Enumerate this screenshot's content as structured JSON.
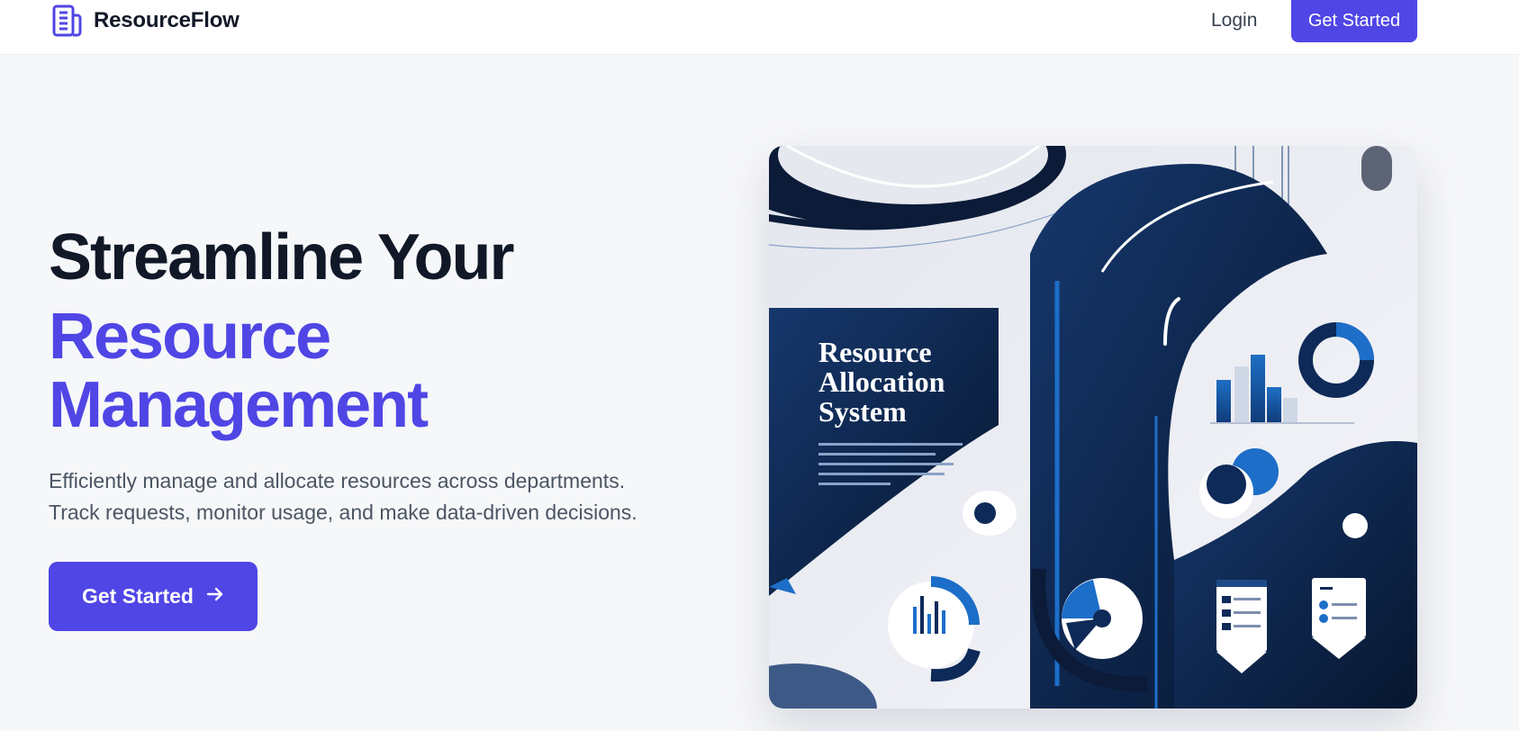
{
  "nav": {
    "brand": "ResourceFlow",
    "login": "Login",
    "cta": "Get Started"
  },
  "hero": {
    "title_line1": "Streamline Your",
    "title_line2": "Resource",
    "title_line3": "Management",
    "subtitle_line1": "Efficiently manage and allocate resources across departments.",
    "subtitle_line2": "Track requests, monitor usage, and make data-driven decisions.",
    "cta": "Get Started",
    "cta_icon": "arrow-right-icon"
  },
  "illustration": {
    "title_line1": "Resource",
    "title_line2": "Allocation",
    "title_line3": "System"
  },
  "colors": {
    "accent": "#4f46e5",
    "navy": "#0f2a56",
    "heading": "#111827"
  }
}
